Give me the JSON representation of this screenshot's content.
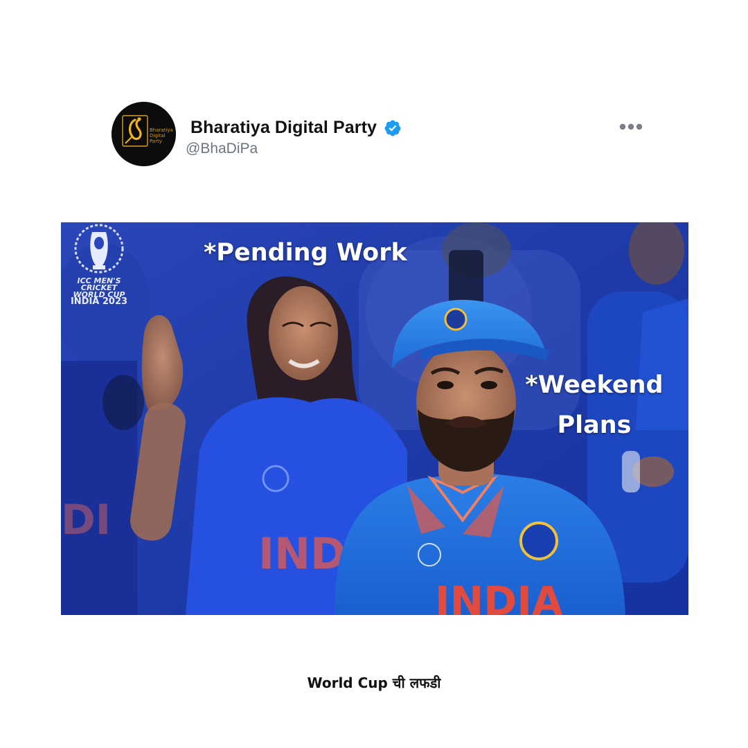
{
  "tweet": {
    "display_name": "Bharatiya Digital Party",
    "handle": "@BhaDiPa",
    "verified": true,
    "avatar_logo_text": [
      "Bharatiya",
      "Digital",
      "Party"
    ],
    "more_icon": "ellipsis-icon",
    "verified_icon": "verified-badge-icon",
    "verified_color": "#1d9bf0"
  },
  "meme": {
    "caption_top": "*Pending Work",
    "caption_right_line1": "*Weekend",
    "caption_right_line2": "Plans",
    "logo": {
      "line1": "ICC MEN'S",
      "line2": "CRICKET",
      "line3": "WORLD CUP",
      "line4": "INDIA 2023"
    },
    "jersey_text_left": "INDIA",
    "jersey_text_center": "INDIA"
  },
  "footer": {
    "caption": "World Cup ची लफडी"
  }
}
